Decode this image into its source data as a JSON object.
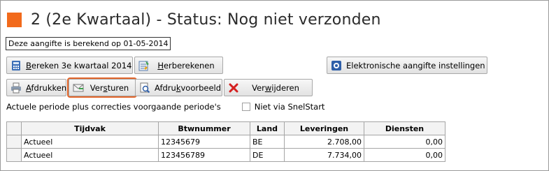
{
  "header": {
    "title": "2 (2e Kwartaal) - Status: Nog niet verzonden",
    "accent_color": "#f26a1b"
  },
  "calc_note": "Deze aangifte is berekend op 01-05-2014",
  "toolbar": {
    "row1": [
      {
        "icon": "calculator-icon",
        "label": "Bereken 3e kwartaal 2014",
        "underline": "B",
        "rest": "ereken 3e kwartaal 2014"
      },
      {
        "icon": "recalculate-icon",
        "label": "Herberekenen",
        "underline": "H",
        "rest": "erberekenen"
      },
      {
        "icon": "settings-icon",
        "label": "Elektronische aangifte instellingen"
      }
    ],
    "row2": [
      {
        "icon": "printer-icon",
        "label": "Afdrukken",
        "underline": "A",
        "rest": "fdrukken"
      },
      {
        "icon": "send-icon",
        "label": "Versturen",
        "pre": "Ver",
        "underline": "s",
        "rest": "turen"
      },
      {
        "icon": "print-preview-icon",
        "label": "Afdrukvoorbeeld",
        "pre": "Afdru",
        "underline": "k",
        "rest": "voorbeeld"
      },
      {
        "icon": "delete-icon",
        "label": "Verwijderen",
        "pre": "Ver",
        "underline": "w",
        "rest": "ijderen"
      }
    ]
  },
  "periode_text": "Actuele periode plus correcties voorgaande periode's",
  "checkbox": {
    "label": "Niet via SnelStart",
    "checked": false
  },
  "table": {
    "columns": [
      "Tijdvak",
      "Btwnummer",
      "Land",
      "Leveringen",
      "Diensten"
    ],
    "rows": [
      [
        "Actueel",
        "12345679",
        "BE",
        "2.708,00",
        "0,00"
      ],
      [
        "Actueel",
        "123456789",
        "DE",
        "7.734,00",
        "0,00"
      ]
    ]
  }
}
